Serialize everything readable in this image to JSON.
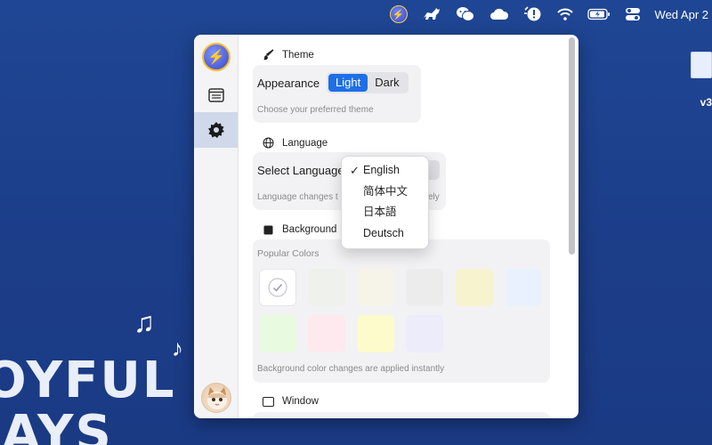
{
  "menubar": {
    "clock": "Wed Apr 2",
    "icons": [
      "app-icon",
      "cat-icon",
      "wechat-icon",
      "cloud-icon",
      "clock-alert-icon",
      "wifi-icon",
      "battery-icon",
      "control-center-icon"
    ]
  },
  "desktop": {
    "file_label": "v3",
    "decoration_text_line1": "OYFUL",
    "decoration_text_line2": "AYS",
    "notes": [
      "♫",
      "♪"
    ]
  },
  "sidebar": {
    "items": [
      "app-logo",
      "general",
      "settings",
      "user-avatar"
    ],
    "active": "settings"
  },
  "theme": {
    "title": "Theme",
    "label": "Appearance",
    "options": [
      "Light",
      "Dark"
    ],
    "selected": "Light",
    "hint": "Choose your preferred theme"
  },
  "language": {
    "title": "Language",
    "label": "Select Language",
    "hint": "Language changes t",
    "hint_tail": "ely",
    "options": [
      "English",
      "简体中文",
      "日本語",
      "Deutsch"
    ],
    "selected": "English",
    "check": "✓"
  },
  "background": {
    "title": "Background",
    "popular_label": "Popular Colors",
    "colors": [
      "#ffffff",
      "#eef1ec",
      "#f6f3e8",
      "#f1f1f1",
      "#f7f3cf",
      "#e9f1fd",
      "#e8fadf",
      "#fde9ee",
      "#fdfacb",
      "#ececfb"
    ],
    "selected_index": 0,
    "hint": "Background color changes are applied instantly"
  },
  "window": {
    "title": "Window"
  },
  "colors": {
    "accent": "#1f6fe6",
    "desktop": "#1d3f8c"
  }
}
